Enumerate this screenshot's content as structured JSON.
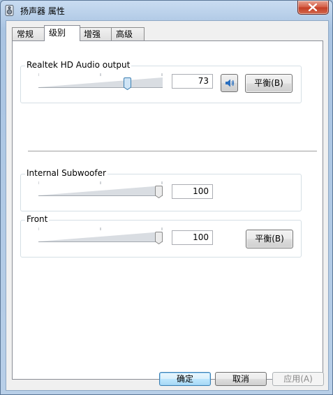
{
  "window": {
    "title": "扬声器 属性",
    "icon": "speaker-icon"
  },
  "tabs": [
    {
      "label": "常规",
      "active": false
    },
    {
      "label": "级别",
      "active": true
    },
    {
      "label": "增强",
      "active": false
    },
    {
      "label": "高级",
      "active": false
    }
  ],
  "channels": [
    {
      "name": "Realtek HD Audio output",
      "value": "73",
      "level": 73,
      "balance_label": "平衡(B)",
      "has_mute": true
    },
    {
      "name": "Internal Subwoofer",
      "value": "100",
      "level": 100,
      "has_mute": false
    },
    {
      "name": "Front",
      "value": "100",
      "level": 100,
      "balance_label": "平衡(B)",
      "has_mute": false
    }
  ],
  "buttons": {
    "ok": "确定",
    "cancel": "取消",
    "apply": "应用(A)"
  },
  "colors": {
    "accent": "#3c7fb1",
    "close": "#c43d25"
  }
}
